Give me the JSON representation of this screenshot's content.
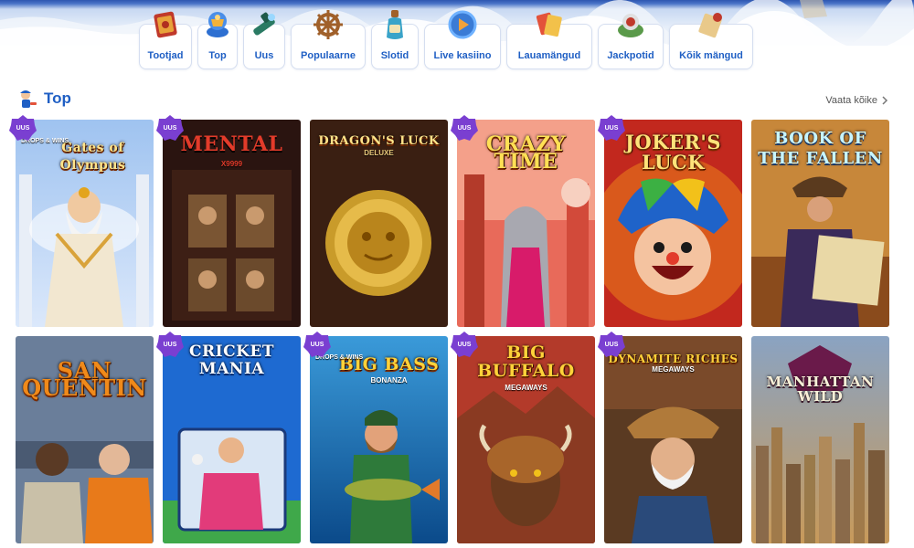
{
  "nav": {
    "categories": [
      {
        "label": "Tootjad",
        "icon": "book-icon"
      },
      {
        "label": "Top",
        "icon": "trophy-icon"
      },
      {
        "label": "Uus",
        "icon": "spyglass-icon"
      },
      {
        "label": "Populaarne",
        "icon": "ship-wheel-icon"
      },
      {
        "label": "Slotid",
        "icon": "bottle-icon"
      },
      {
        "label": "Live kasiino",
        "icon": "play-globe-icon"
      },
      {
        "label": "Lauamängud",
        "icon": "cards-icon"
      },
      {
        "label": "Jackpotid",
        "icon": "treasure-icon"
      },
      {
        "label": "Kõik mängud",
        "icon": "map-scroll-icon"
      }
    ]
  },
  "section": {
    "title": "Top",
    "see_all": "Vaata kõike",
    "icon": "pirate-icon"
  },
  "badge_text": "UUS",
  "drops_text": "DROPS & WINS",
  "colors": {
    "brand": "#1f5fc4",
    "badge": "#7a3fd1"
  },
  "games": [
    {
      "title": "Gates of Olympus",
      "new": true,
      "drops": true
    },
    {
      "title": "MENTAL",
      "subtitle": "X9999",
      "new": true,
      "drops": false
    },
    {
      "title": "DRAGON'S LUCK",
      "subtitle": "DELUXE",
      "new": false,
      "drops": false
    },
    {
      "title": "CRAZY TIME",
      "new": true,
      "drops": false
    },
    {
      "title": "JOKER'S LUCK",
      "new": true,
      "drops": false
    },
    {
      "title": "BOOK OF THE FALLEN",
      "new": false,
      "drops": false
    },
    {
      "title": "SAN QUENTIN",
      "new": false,
      "drops": false
    },
    {
      "title": "CRICKET MANIA",
      "new": true,
      "drops": false
    },
    {
      "title": "BIG BASS",
      "subtitle": "BONANZA",
      "new": true,
      "drops": true
    },
    {
      "title": "BIG BUFFALO",
      "subtitle": "MEGAWAYS",
      "new": true,
      "drops": false
    },
    {
      "title": "DYNAMITE RICHES",
      "subtitle": "MEGAWAYS",
      "new": true,
      "drops": false
    },
    {
      "title": "MANHATTAN WILD",
      "new": false,
      "drops": false
    }
  ]
}
